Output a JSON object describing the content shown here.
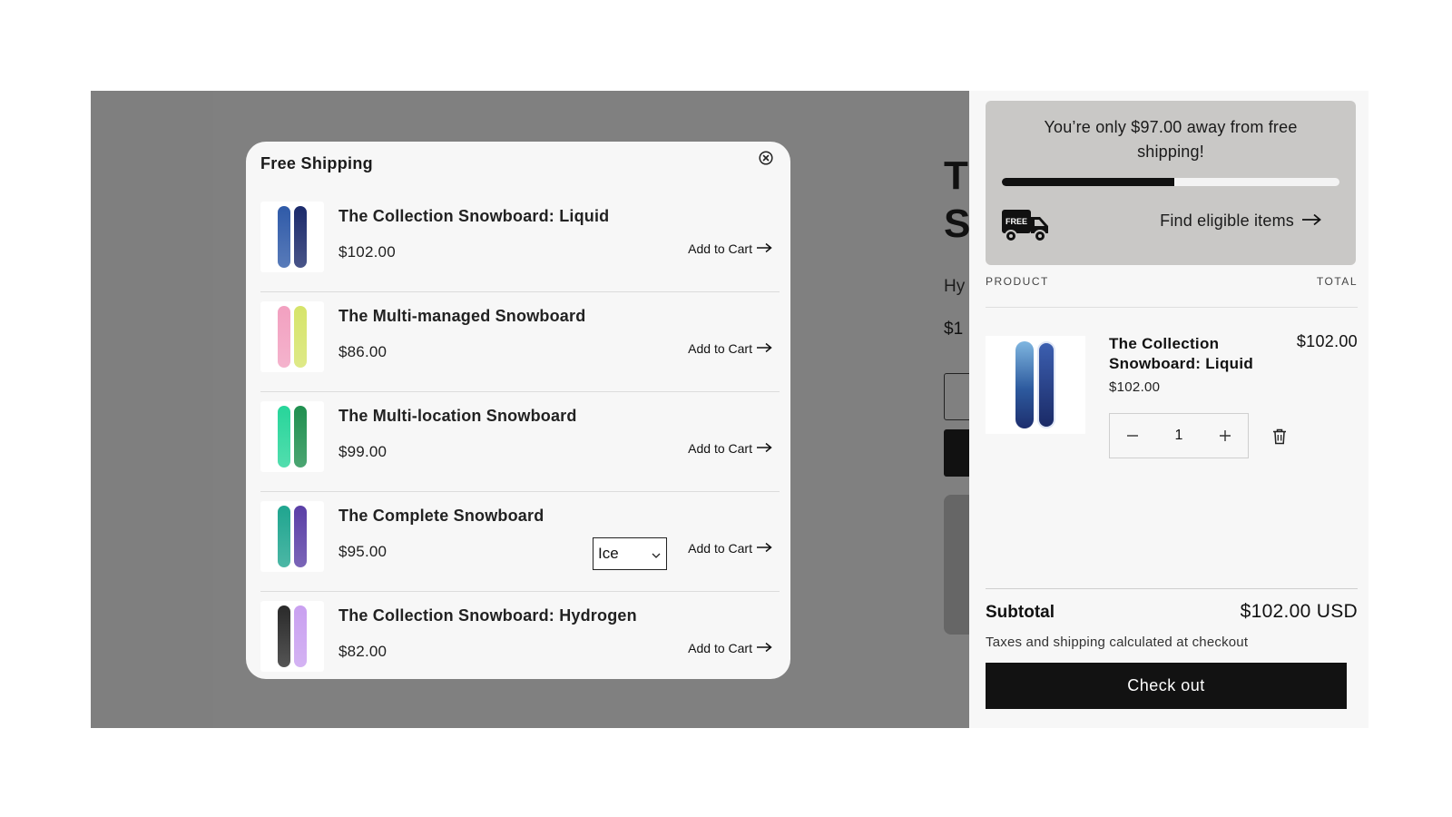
{
  "background_page": {
    "title_line1": "T",
    "title_line2": "S",
    "vendor": "Hy",
    "price": "$1"
  },
  "modal": {
    "title": "Free Shipping",
    "close_icon": "close-circle-icon",
    "add_to_cart_label": "Add to Cart",
    "items": [
      {
        "name": "The Collection Snowboard: Liquid",
        "price": "$102.00",
        "colors": [
          "#2f5aa8",
          "#1b2a6b"
        ]
      },
      {
        "name": "The Multi-managed Snowboard",
        "price": "$86.00",
        "colors": [
          "#f2a0c0",
          "#d6e46a"
        ]
      },
      {
        "name": "The Multi-location Snowboard",
        "price": "$99.00",
        "colors": [
          "#27d59a",
          "#1f8f4f"
        ]
      },
      {
        "name": "The Complete Snowboard",
        "price": "$95.00",
        "colors": [
          "#1fa58f",
          "#5a3fa6"
        ],
        "variant": "Ice"
      },
      {
        "name": "The Collection Snowboard: Hydrogen",
        "price": "$82.00",
        "colors": [
          "#2a2a2a",
          "#c9a0f0"
        ]
      }
    ]
  },
  "cart": {
    "shipping_message": "You’re only $97.00 away from free shipping!",
    "shipping_progress": 0.51,
    "truck_badge": "FREE",
    "find_link": "Find eligible items",
    "col_product": "PRODUCT",
    "col_total": "TOTAL",
    "line_item": {
      "name": "The Collection Snowboard: Liquid",
      "unit_price": "$102.00",
      "line_total": "$102.00",
      "quantity": "1"
    },
    "subtotal_label": "Subtotal",
    "subtotal_value": "$102.00 USD",
    "tax_note": "Taxes and shipping calculated at checkout",
    "checkout_label": "Check out"
  }
}
